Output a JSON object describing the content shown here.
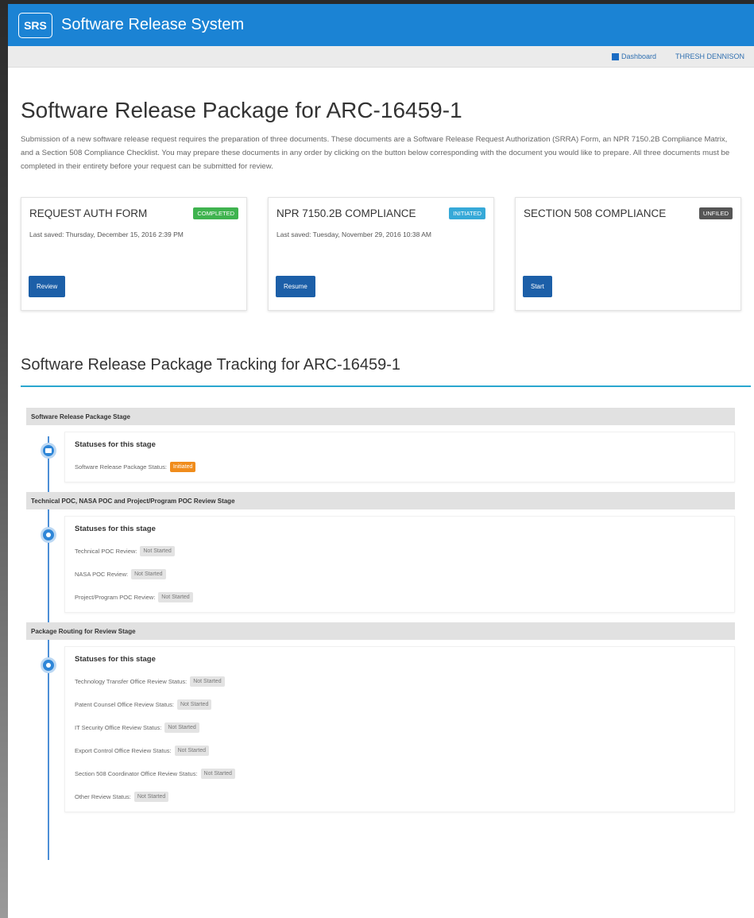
{
  "app": {
    "logo": "SRS",
    "title": "Software Release System"
  },
  "nav": {
    "dashboard": "Dashboard",
    "user": "THRESH DENNISON"
  },
  "page_title": "Software Release Package for ARC-16459-1",
  "intro": "Submission of a new software release request requires the preparation of three documents. These documents are a Software Release Request Authorization (SRRA) Form, an NPR 7150.2B Compliance Matrix, and a Section 508 Compliance Checklist. You may prepare these documents in any order by clicking on the button below corresponding with the document you would like to prepare. All three documents must be completed in their entirety before your request can be submitted for review.",
  "cards": [
    {
      "title": "REQUEST AUTH FORM",
      "badge": "COMPLETED",
      "saved": "Last saved: Thursday, December 15, 2016 2:39 PM",
      "button": "Review"
    },
    {
      "title": "NPR 7150.2B COMPLIANCE",
      "badge": "INITIATED",
      "saved": "Last saved: Tuesday, November 29, 2016 10:38 AM",
      "button": "Resume"
    },
    {
      "title": "SECTION 508 COMPLIANCE",
      "badge": "UNFILED",
      "saved": "",
      "button": "Start"
    }
  ],
  "tracking_title": "Software Release Package Tracking for ARC-16459-1",
  "stages": [
    {
      "name": "Software Release Package Stage",
      "heading": "Statuses for this stage",
      "statuses": [
        {
          "label": "Software Release Package Status:",
          "value": "Initiated"
        }
      ]
    },
    {
      "name": "Technical POC, NASA POC and Project/Program POC Review Stage",
      "heading": "Statuses for this stage",
      "statuses": [
        {
          "label": "Technical POC Review:",
          "value": "Not Started"
        },
        {
          "label": "NASA POC Review:",
          "value": "Not Started"
        },
        {
          "label": "Project/Program POC Review:",
          "value": "Not Started"
        }
      ]
    },
    {
      "name": "Package Routing for Review Stage",
      "heading": "Statuses for this stage",
      "statuses": [
        {
          "label": "Technology Transfer Office Review Status:",
          "value": "Not Started"
        },
        {
          "label": "Patent Counsel Office Review Status:",
          "value": "Not Started"
        },
        {
          "label": "IT Security Office Review Status:",
          "value": "Not Started"
        },
        {
          "label": "Export Control Office Review Status:",
          "value": "Not Started"
        },
        {
          "label": "Section 508 Coordinator Office Review Status:",
          "value": "Not Started"
        },
        {
          "label": "Other Review Status:",
          "value": "Not Started"
        }
      ]
    }
  ],
  "colors": {
    "brand": "#1b83d4",
    "completed": "#3fb34f",
    "initiated": "#36a9d8",
    "unfiled": "#555555",
    "primary_button": "#1c5fa8",
    "status_initiated": "#f08c1c"
  }
}
